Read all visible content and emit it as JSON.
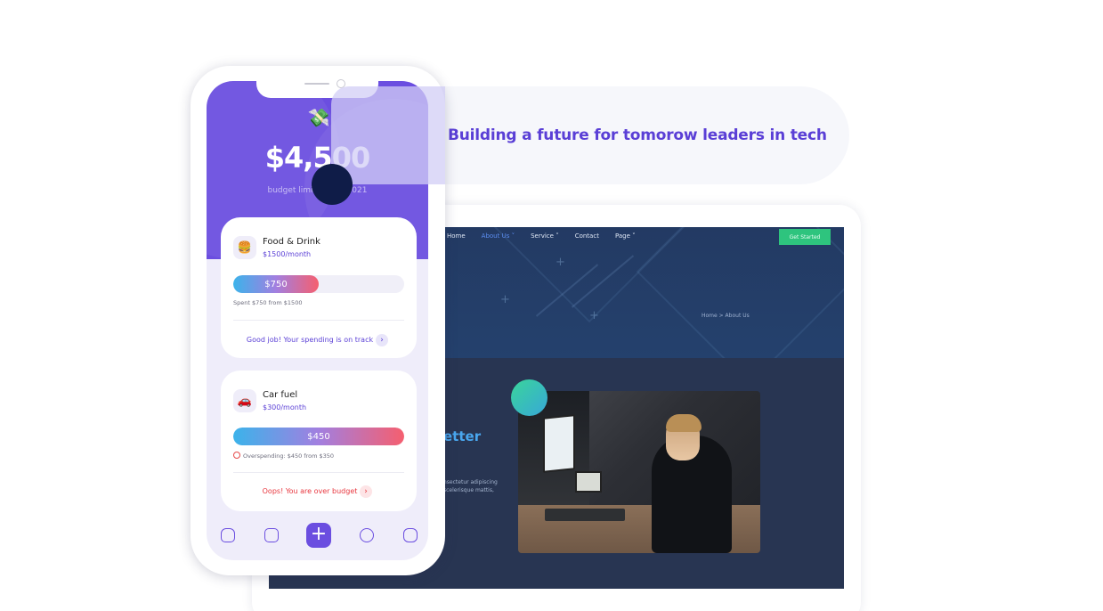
{
  "headline": "Building  a future for tomorow leaders in tech",
  "website": {
    "nav": [
      "Home",
      "About Us ˅",
      "Service ˅",
      "Contact",
      "Page ˅"
    ],
    "cta": "Get Started",
    "breadcrumb": "Home  >  About Us",
    "heading_fragment": "etter",
    "body_fragment_1": "nsectetur adipiscing",
    "body_fragment_2": "scelerisque mattis,"
  },
  "app": {
    "balance": "$4,500",
    "subtitle_left": "budget limi",
    "subtitle_right": "2021",
    "tabs": [
      "home-icon",
      "wallet-icon",
      "add-icon",
      "chart-icon",
      "more-icon"
    ],
    "add_symbol": "+",
    "budgets": [
      {
        "name": "Food & Drink",
        "limit": "$1500",
        "period": "/month",
        "icon": "🍔",
        "spent_label": "$750",
        "spent_fraction": 0.5,
        "note": "Spent $750 from $1500",
        "message": "Good job! Your spending is on track",
        "status": "ok"
      },
      {
        "name": "Car fuel",
        "limit": "$300",
        "period": "/month",
        "icon": "🚗",
        "spent_label": "$450",
        "spent_fraction": 1.0,
        "note": "Overspending: $450 from $350",
        "message": "Oops! You are over budget",
        "status": "over"
      }
    ]
  },
  "colors": {
    "brand": "#6b4ee0",
    "accent_text": "#5a3fd6",
    "danger": "#e8363e",
    "site_bg": "#283552"
  }
}
